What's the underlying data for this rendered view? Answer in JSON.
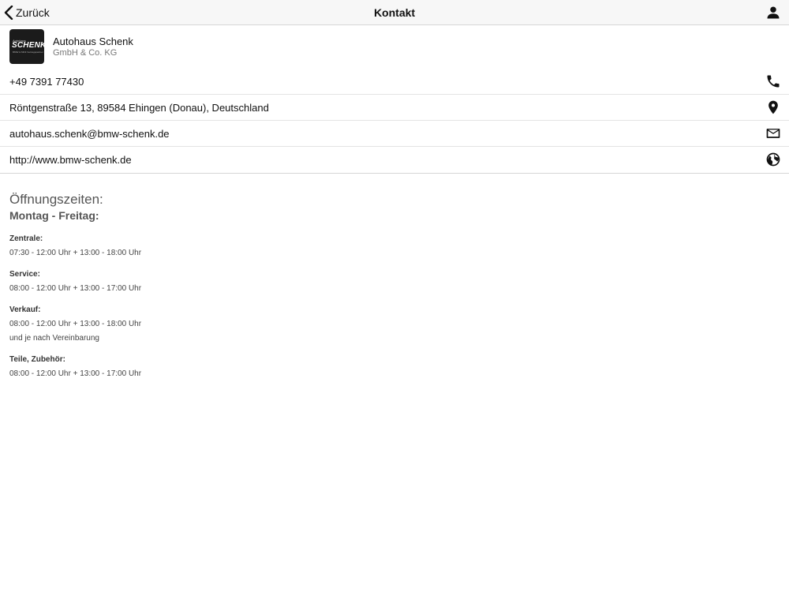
{
  "navbar": {
    "back_label": "Zurück",
    "title": "Kontakt",
    "profile_icon": "person-icon"
  },
  "company": {
    "logo_text": "SCHENK",
    "logo_small": "Autohaus",
    "logo_sub": "BMW & MINI Vertragspartner",
    "name": "Autohaus Schenk",
    "subtitle": "GmbH & Co. KG"
  },
  "contacts": [
    {
      "text": "+49 7391 77430",
      "icon": "phone-icon"
    },
    {
      "text": "Röntgenstraße 13, 89584 Ehingen (Donau), Deutschland",
      "icon": "location-pin-icon"
    },
    {
      "text": "autohaus.schenk@bmw-schenk.de",
      "icon": "mail-icon"
    },
    {
      "text": "http://www.bmw-schenk.de",
      "icon": "globe-icon"
    }
  ],
  "hours": {
    "title": "Öffnungszeiten:",
    "days": "Montag - Freitag:",
    "departments": [
      {
        "label": "Zentrale:",
        "lines": [
          "07:30 - 12:00 Uhr + 13:00 - 18:00 Uhr"
        ]
      },
      {
        "label": "Service:",
        "lines": [
          "08:00 - 12:00 Uhr + 13:00 - 17:00 Uhr"
        ]
      },
      {
        "label": "Verkauf:",
        "lines": [
          "08:00 - 12:00 Uhr + 13:00 - 18:00 Uhr",
          "und je nach Vereinbarung"
        ]
      },
      {
        "label": "Teile, Zubehör:",
        "lines": [
          "08:00 - 12:00 Uhr + 13:00 - 17:00 Uhr"
        ]
      }
    ]
  }
}
